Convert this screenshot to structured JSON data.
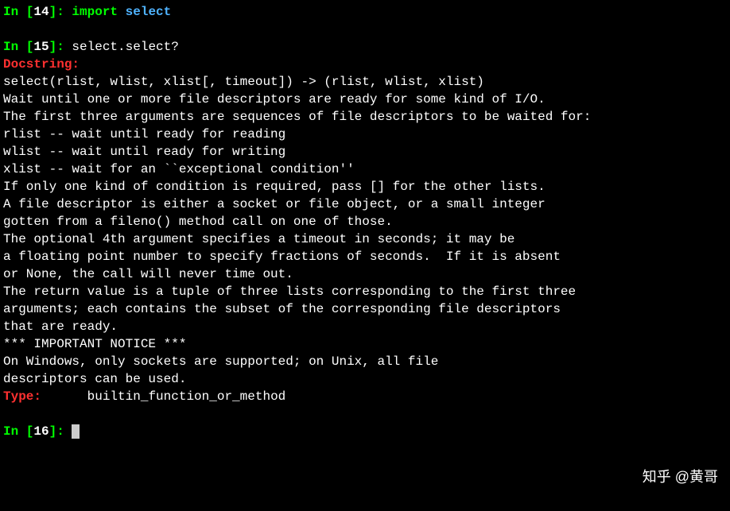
{
  "cells": [
    {
      "prompt_prefix": "In [",
      "prompt_num": "14",
      "prompt_suffix": "]: ",
      "code_keyword": "import",
      "code_module": "select"
    },
    {
      "prompt_prefix": "In [",
      "prompt_num": "15",
      "prompt_suffix": "]: ",
      "code_text": "select.select?"
    }
  ],
  "doc": {
    "docstring_label": "Docstring:",
    "type_label": "Type:",
    "type_value": "builtin_function_or_method",
    "lines": [
      "select(rlist, wlist, xlist[, timeout]) -> (rlist, wlist, xlist)",
      "",
      "Wait until one or more file descriptors are ready for some kind of I/O.",
      "The first three arguments are sequences of file descriptors to be waited for:",
      "rlist -- wait until ready for reading",
      "wlist -- wait until ready for writing",
      "xlist -- wait for an ``exceptional condition''",
      "If only one kind of condition is required, pass [] for the other lists.",
      "A file descriptor is either a socket or file object, or a small integer",
      "gotten from a fileno() method call on one of those.",
      "",
      "The optional 4th argument specifies a timeout in seconds; it may be",
      "a floating point number to specify fractions of seconds.  If it is absent",
      "or None, the call will never time out.",
      "",
      "The return value is a tuple of three lists corresponding to the first three",
      "arguments; each contains the subset of the corresponding file descriptors",
      "that are ready.",
      "",
      "*** IMPORTANT NOTICE ***",
      "On Windows, only sockets are supported; on Unix, all file",
      "descriptors can be used."
    ]
  },
  "next_prompt": {
    "prompt_prefix": "In [",
    "prompt_num": "16",
    "prompt_suffix": "]: "
  },
  "watermark": "知乎 @黄哥"
}
